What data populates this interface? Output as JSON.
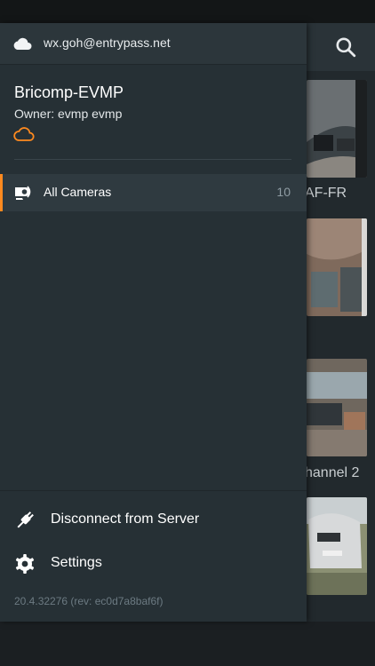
{
  "drawer": {
    "account_email": "wx.goh@entrypass.net",
    "server_name": "Bricomp-EVMP",
    "server_owner": "Owner: evmp evmp",
    "nav": {
      "all_cameras_label": "All Cameras",
      "all_cameras_count": "10"
    },
    "menu": {
      "disconnect_label": "Disconnect from Server",
      "settings_label": "Settings"
    },
    "version": "20.4.32276 (rev: ec0d7a8baf6f)"
  },
  "background": {
    "camera_captions": [
      "AF-FR",
      "hannel 2"
    ]
  },
  "colors": {
    "accent": "#ff8a1f",
    "drawer_bg": "#263035",
    "header_bg": "#2c363b"
  },
  "icons": {
    "account": "cloud-icon",
    "server_status": "cloud-outline-icon",
    "all_cameras": "camera-icon",
    "disconnect": "plug-icon",
    "settings": "gear-icon",
    "search": "search-icon"
  }
}
